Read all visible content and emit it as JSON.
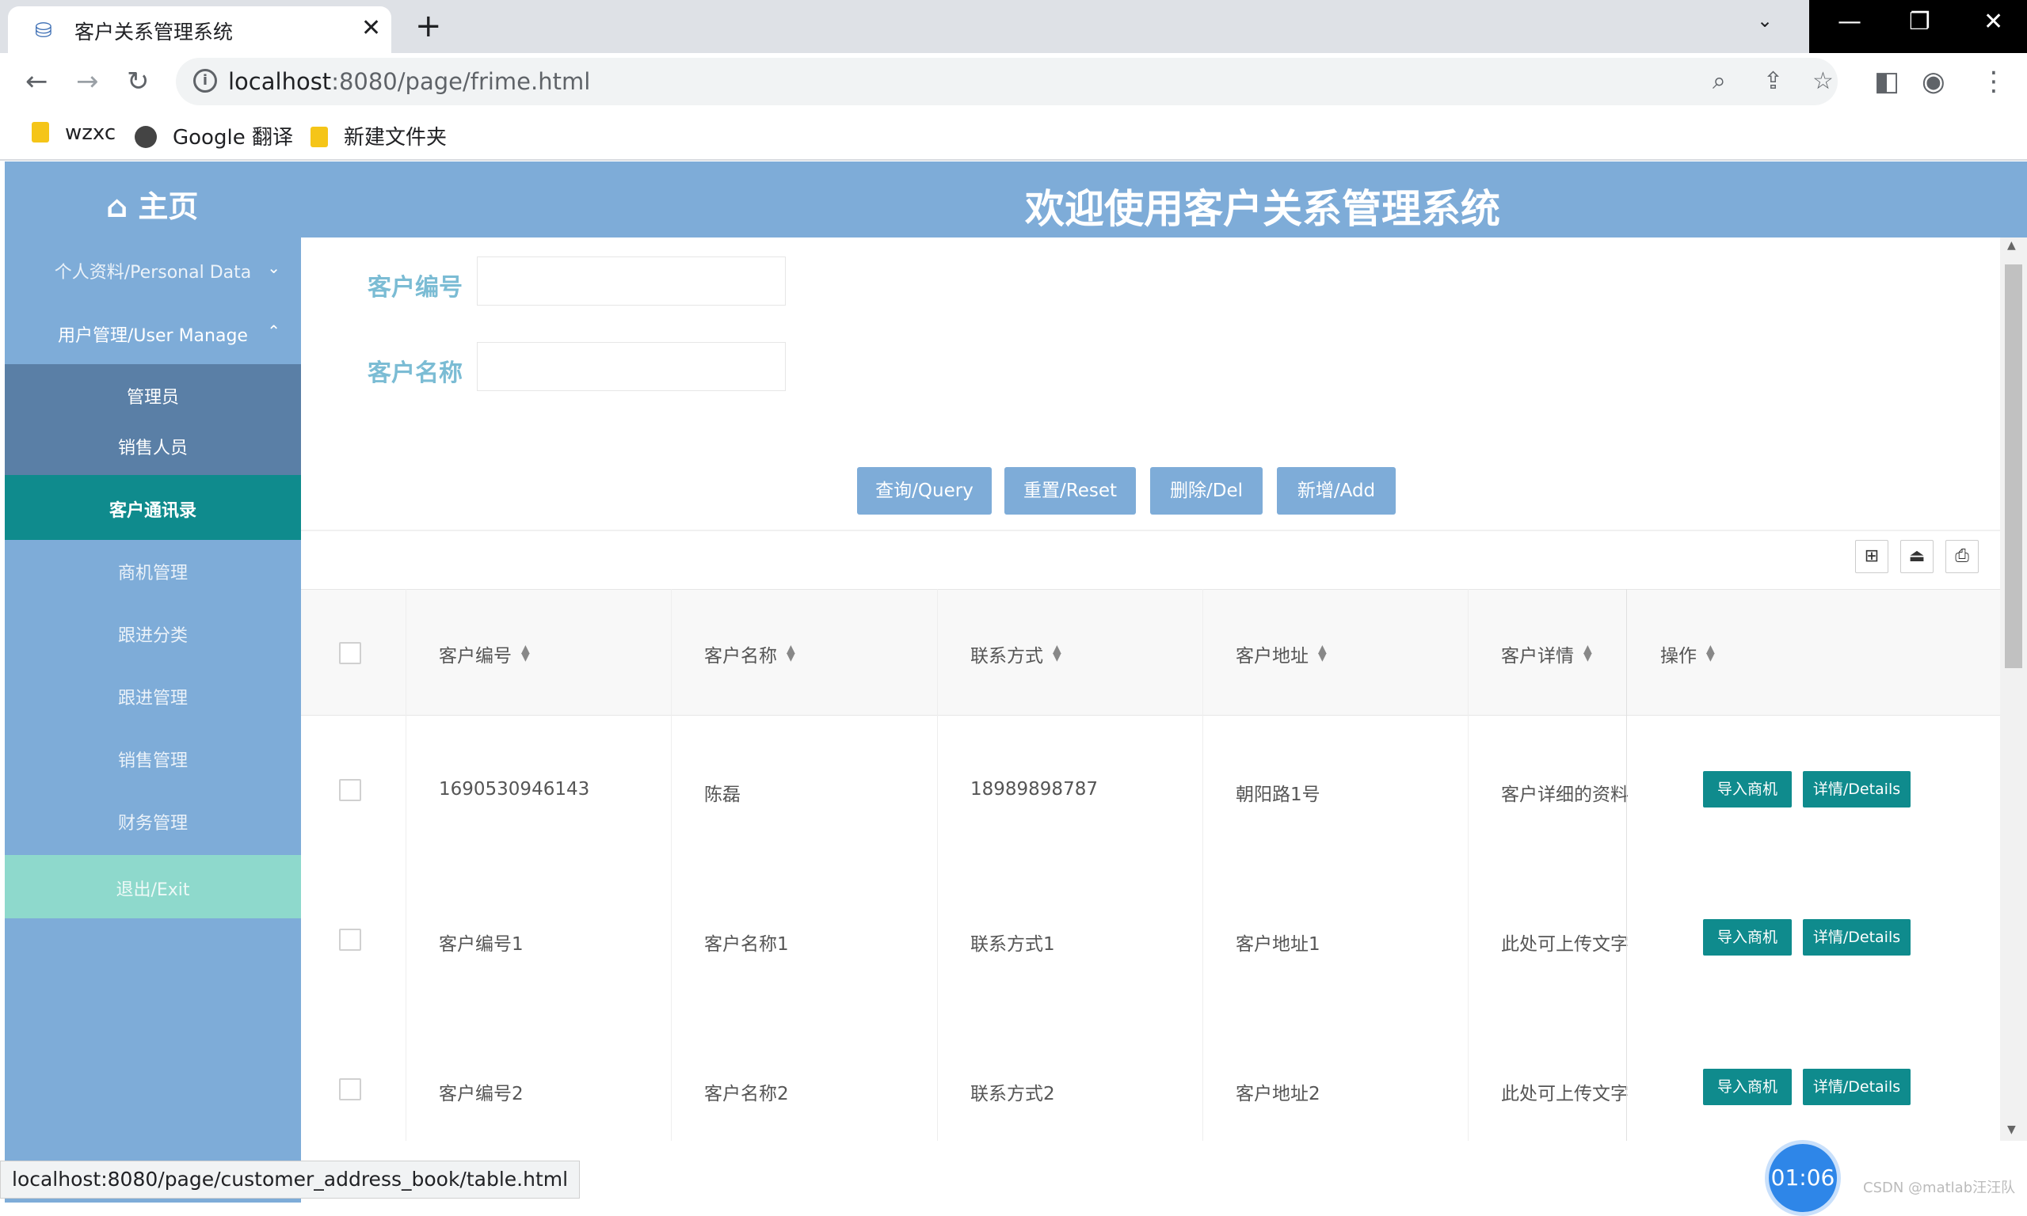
{
  "browser": {
    "tab_title": "客户关系管理系统",
    "tab_close": "✕",
    "new_tab": "+",
    "url_host": "localhost",
    "url_path": ":8080/page/frime.html",
    "bookmarks": [
      "wzxc",
      "Google 翻译",
      "新建文件夹"
    ],
    "status_url": "localhost:8080/page/customer_address_book/table.html"
  },
  "header": {
    "home": "⌂ 主页",
    "welcome": "欢迎使用客户关系管理系统"
  },
  "sidebar": {
    "personal": "个人资料/Personal Data",
    "user_manage": "用户管理/User Manage",
    "sub_items": [
      "管理员",
      "销售人员"
    ],
    "items": [
      "客户通讯录",
      "商机管理",
      "跟进分类",
      "跟进管理",
      "销售管理",
      "财务管理"
    ],
    "exit": "退出/Exit"
  },
  "form": {
    "customer_id_label": "客户编号",
    "customer_name_label": "客户名称"
  },
  "buttons": {
    "query": "查询/Query",
    "reset": "重置/Reset",
    "delete": "删除/Del",
    "add": "新增/Add"
  },
  "table": {
    "columns": [
      "客户编号",
      "客户名称",
      "联系方式",
      "客户地址",
      "客户详情",
      "操作"
    ],
    "rows": [
      [
        "1690530946143",
        "陈磊",
        "18989898787",
        "朝阳路1号",
        "客户详细的资料"
      ],
      [
        "客户编号1",
        "客户名称1",
        "联系方式1",
        "客户地址1",
        "此处可上传文字"
      ],
      [
        "客户编号2",
        "客户名称2",
        "联系方式2",
        "客户地址2",
        "此处可上传文字"
      ]
    ],
    "action_import": "导入商机",
    "action_details": "详情/Details"
  },
  "timer": "01:06",
  "watermark": "CSDN @matlab汪汪队",
  "colors": {
    "header": "#7eacd8",
    "active": "#0f8b8d",
    "exit": "#8ed9cc",
    "submenu": "#5a7fa6"
  }
}
